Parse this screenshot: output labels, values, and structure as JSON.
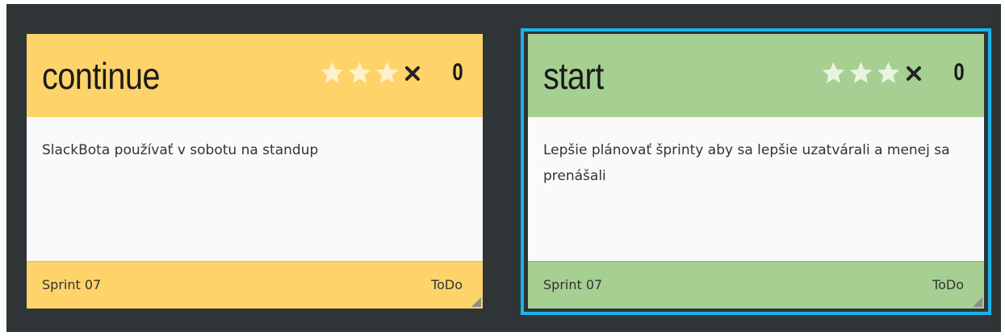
{
  "colors": {
    "board_background": "#2f3437",
    "continue_card": "#fdd36a",
    "start_card": "#a6cf92",
    "card_body": "#fafafa",
    "selection_outline": "#17b5ea",
    "star_inactive": "#fff2cc"
  },
  "cards": [
    {
      "title": "continue",
      "rating_stars": 3,
      "rating_value": 0,
      "remove_icon": "close-icon",
      "vote_count": "0",
      "text": "SlackBota používať v sobotu na standup",
      "sprint": "Sprint 07",
      "status": "ToDo",
      "selected": false
    },
    {
      "title": "start",
      "rating_stars": 3,
      "rating_value": 0,
      "remove_icon": "close-icon",
      "vote_count": "0",
      "text": "Lepšie plánovať šprinty aby sa lepšie uzatvárali a menej sa prenášali",
      "sprint": "Sprint 07",
      "status": "ToDo",
      "selected": true
    }
  ]
}
